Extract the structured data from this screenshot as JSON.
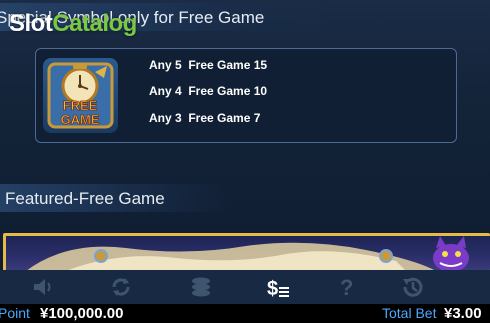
{
  "watermark": {
    "part1": "Slot",
    "part2": "Catalog"
  },
  "sections": {
    "special": {
      "title": "Special Symbol only for Free Game"
    },
    "featured": {
      "title": "Featured-Free Game"
    }
  },
  "symbol": {
    "name": "free-game-clock-icon",
    "lines": [
      "FREE",
      "GAME"
    ],
    "paytable": [
      "Any 5  Free Game 15",
      "Any 4  Free Game 10",
      "Any 3  Free Game 7"
    ]
  },
  "toolbar": {
    "icons": [
      "sound-icon",
      "autoplay-icon",
      "chips-icon",
      "paytable-icon",
      "help-icon",
      "history-icon"
    ]
  },
  "status": {
    "point_label": "Point",
    "point_value": "¥100,000.00",
    "bet_label": "Total Bet",
    "bet_value": "¥3.00"
  },
  "colors": {
    "accent": "#4aa9ff",
    "panel_border": "#4e6a93",
    "watermark_green": "#7ac943"
  }
}
